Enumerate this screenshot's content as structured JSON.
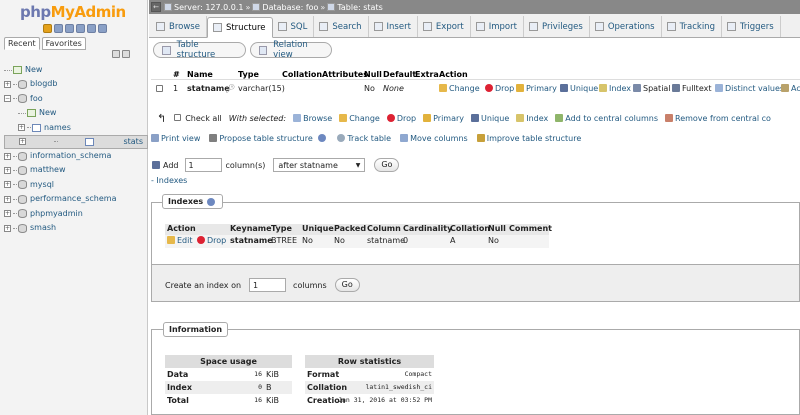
{
  "sidebar": {
    "logo": {
      "php": "php",
      "my": "My",
      "admin": "Admin"
    },
    "tabs": {
      "recent": "Recent",
      "favorites": "Favorites"
    },
    "tree": [
      {
        "label": "New",
        "kind": "new",
        "depth": 0
      },
      {
        "label": "blogdb",
        "kind": "db",
        "depth": 0
      },
      {
        "label": "foo",
        "kind": "db",
        "depth": 0
      },
      {
        "label": "New",
        "kind": "new",
        "depth": 1
      },
      {
        "label": "names",
        "kind": "table",
        "depth": 1
      },
      {
        "label": "stats",
        "kind": "table",
        "depth": 1,
        "selected": true
      },
      {
        "label": "information_schema",
        "kind": "db",
        "depth": 0
      },
      {
        "label": "matthew",
        "kind": "db",
        "depth": 0
      },
      {
        "label": "mysql",
        "kind": "db",
        "depth": 0
      },
      {
        "label": "performance_schema",
        "kind": "db",
        "depth": 0
      },
      {
        "label": "phpmyadmin",
        "kind": "db",
        "depth": 0
      },
      {
        "label": "smash",
        "kind": "db",
        "depth": 0
      }
    ]
  },
  "breadcrumb": {
    "server": "Server: 127.0.0.1",
    "database": "Database: foo",
    "table": "Table: stats",
    "separator": "»"
  },
  "nav_tabs": [
    {
      "label": "Browse",
      "active": false
    },
    {
      "label": "Structure",
      "active": true
    },
    {
      "label": "SQL",
      "active": false
    },
    {
      "label": "Search",
      "active": false
    },
    {
      "label": "Insert",
      "active": false
    },
    {
      "label": "Export",
      "active": false
    },
    {
      "label": "Import",
      "active": false
    },
    {
      "label": "Privileges",
      "active": false
    },
    {
      "label": "Operations",
      "active": false
    },
    {
      "label": "Tracking",
      "active": false
    },
    {
      "label": "Triggers",
      "active": false
    }
  ],
  "subtabs": {
    "table_structure": "Table structure",
    "relation_view": "Relation view"
  },
  "structure": {
    "headers": {
      "num": "#",
      "name": "Name",
      "type": "Type",
      "collation": "Collation",
      "attributes": "Attributes",
      "null": "Null",
      "default": "Default",
      "extra": "Extra",
      "action": "Action"
    },
    "row": {
      "num": "1",
      "name": "statname",
      "type": "varchar(15)",
      "null": "No",
      "default": "None"
    },
    "actions": {
      "change": "Change",
      "drop": "Drop",
      "primary": "Primary",
      "unique": "Unique",
      "index": "Index",
      "spatial": "Spatial",
      "fulltext": "Fulltext",
      "distinct": "Distinct values",
      "more": "Ac"
    }
  },
  "with_selected": {
    "check_all": "Check all",
    "label": "With selected:",
    "browse": "Browse",
    "change": "Change",
    "drop": "Drop",
    "primary": "Primary",
    "unique": "Unique",
    "index": "Index",
    "central": "Add to central columns",
    "remove_central": "Remove from central co"
  },
  "tools": {
    "print": "Print view",
    "propose": "Propose table structure",
    "track": "Track table",
    "move": "Move columns",
    "improve": "Improve table structure"
  },
  "add_column": {
    "label": "Add",
    "value": "1",
    "unit": "column(s)",
    "position": "after statname",
    "go": "Go"
  },
  "indexes_link": "- Indexes",
  "indexes": {
    "legend": "Indexes",
    "headers": {
      "action": "Action",
      "keyname": "Keyname",
      "type": "Type",
      "unique": "Unique",
      "packed": "Packed",
      "column": "Column",
      "cardinality": "Cardinality",
      "collation": "Collation",
      "null": "Null",
      "comment": "Comment"
    },
    "row": {
      "edit": "Edit",
      "drop": "Drop",
      "keyname": "statname",
      "type": "BTREE",
      "unique": "No",
      "packed": "No",
      "column": "statname",
      "cardinality": "0",
      "collation": "A",
      "null": "No"
    }
  },
  "create_index": {
    "label": "Create an index on",
    "value": "1",
    "unit": "columns",
    "go": "Go"
  },
  "information": {
    "legend": "Information",
    "space": {
      "title": "Space usage",
      "rows": [
        {
          "k": "Data",
          "v": "16",
          "u": "KiB"
        },
        {
          "k": "Index",
          "v": "0",
          "u": "B"
        },
        {
          "k": "Total",
          "v": "16",
          "u": "KiB"
        }
      ]
    },
    "rowstats": {
      "title": "Row statistics",
      "format_k": "Format",
      "format_v": "Compact",
      "collation_k": "Collation",
      "collation_v": "latin1_swedish_ci",
      "creation_k": "Creation",
      "creation_v": "Jan 31, 2016 at 03:52 PM"
    }
  }
}
